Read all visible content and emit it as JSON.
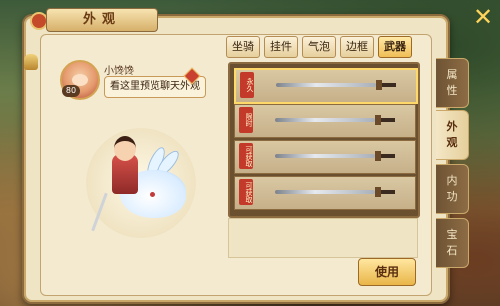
{
  "window": {
    "title": "外观"
  },
  "player": {
    "name": "小馋馋",
    "level": "80",
    "bubble_text": "看这里预览聊天外观"
  },
  "tabs": [
    {
      "label": "坐骑",
      "active": false
    },
    {
      "label": "挂件",
      "active": false
    },
    {
      "label": "气泡",
      "active": false
    },
    {
      "label": "边框",
      "active": false
    },
    {
      "label": "武器",
      "active": true
    }
  ],
  "weapons": [
    {
      "tag": "永久",
      "selected": true
    },
    {
      "tag": "限时",
      "selected": false
    },
    {
      "tag": "可获取",
      "selected": false
    },
    {
      "tag": "可获取",
      "selected": false
    }
  ],
  "actions": {
    "use_label": "使用"
  },
  "side_tabs": [
    {
      "label": "属性",
      "active": false
    },
    {
      "label": "外观",
      "active": true
    },
    {
      "label": "内功",
      "active": false
    },
    {
      "label": "宝石",
      "active": false
    }
  ],
  "icons": {
    "close": "close-icon",
    "bell": "bell-icon"
  },
  "colors": {
    "accent": "#f0be56",
    "tag_red": "#c43a2a"
  }
}
